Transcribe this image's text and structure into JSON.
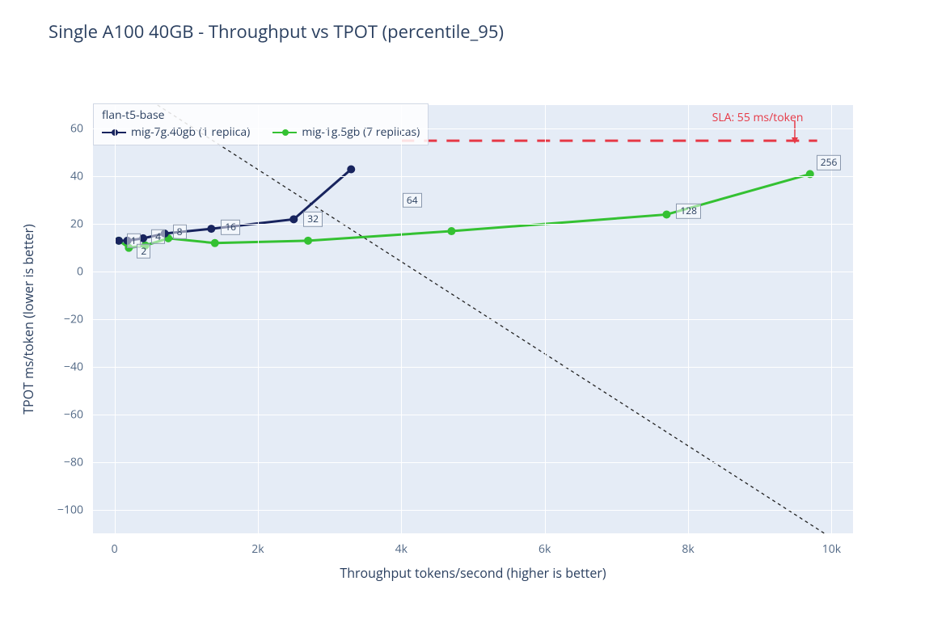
{
  "title": "Single A100 40GB - Throughput vs TPOT (percentile_95)",
  "xlabel": "Throughput tokens/second (higher is better)",
  "ylabel": "TPOT ms/token (lower is better)",
  "legend": {
    "title": "flan-t5-base",
    "items": [
      {
        "label": "mig-7g.40gb (1 replica)",
        "color": "#18245e"
      },
      {
        "label": "mig-1g.5gb (7 replicas)",
        "color": "#34c132"
      }
    ]
  },
  "sla_label": "SLA: 55 ms/token",
  "chart_data": {
    "type": "line",
    "xlabel": "Throughput tokens/second (higher is better)",
    "ylabel": "TPOT ms/token (lower is better)",
    "title": "Single A100 40GB - Throughput vs TPOT (percentile_95)",
    "xlim": [
      -300,
      10300
    ],
    "ylim": [
      -110,
      70
    ],
    "x_ticks": [
      0,
      2000,
      4000,
      6000,
      8000,
      10000
    ],
    "x_tick_labels": [
      "0",
      "2k",
      "4k",
      "6k",
      "8k",
      "10k"
    ],
    "y_ticks": [
      -100,
      -80,
      -60,
      -40,
      -20,
      0,
      20,
      40,
      60
    ],
    "y_tick_labels": [
      "−100",
      "−80",
      "−60",
      "−40",
      "−20",
      "0",
      "20",
      "40",
      "60"
    ],
    "sla": {
      "y": 55,
      "label": "SLA: 55 ms/token",
      "x0": 4000,
      "x1": 9800
    },
    "diagonal": {
      "x0": 600,
      "y0": 70,
      "x1": 9900,
      "y1": -110
    },
    "sizes": [
      1,
      2,
      4,
      8,
      16,
      32,
      64,
      128,
      256
    ],
    "series": [
      {
        "name": "mig-7g.40gb (1 replica)",
        "color": "#18245e",
        "points": [
          {
            "x": 60,
            "y": 13,
            "label": "1"
          },
          {
            "x": 180,
            "y": 13,
            "label": "2"
          },
          {
            "x": 400,
            "y": 14,
            "label": "4"
          },
          {
            "x": 700,
            "y": 16,
            "label": "8"
          },
          {
            "x": 1350,
            "y": 18,
            "label": "16"
          },
          {
            "x": 2500,
            "y": 22,
            "label": "32"
          },
          {
            "x": 3300,
            "y": 43,
            "label": "64"
          }
        ]
      },
      {
        "name": "mig-1g.5gb (7 replicas)",
        "color": "#34c132",
        "points": [
          {
            "x": 60,
            "y": 13,
            "label": "1"
          },
          {
            "x": 200,
            "y": 10,
            "label": "2"
          },
          {
            "x": 430,
            "y": 11,
            "label": "4"
          },
          {
            "x": 750,
            "y": 14,
            "label": "8"
          },
          {
            "x": 1400,
            "y": 12,
            "label": "16"
          },
          {
            "x": 2700,
            "y": 13,
            "label": "32"
          },
          {
            "x": 4700,
            "y": 17,
            "label": "64"
          },
          {
            "x": 7700,
            "y": 24,
            "label": "128"
          },
          {
            "x": 9700,
            "y": 41,
            "label": "256"
          }
        ]
      }
    ]
  }
}
